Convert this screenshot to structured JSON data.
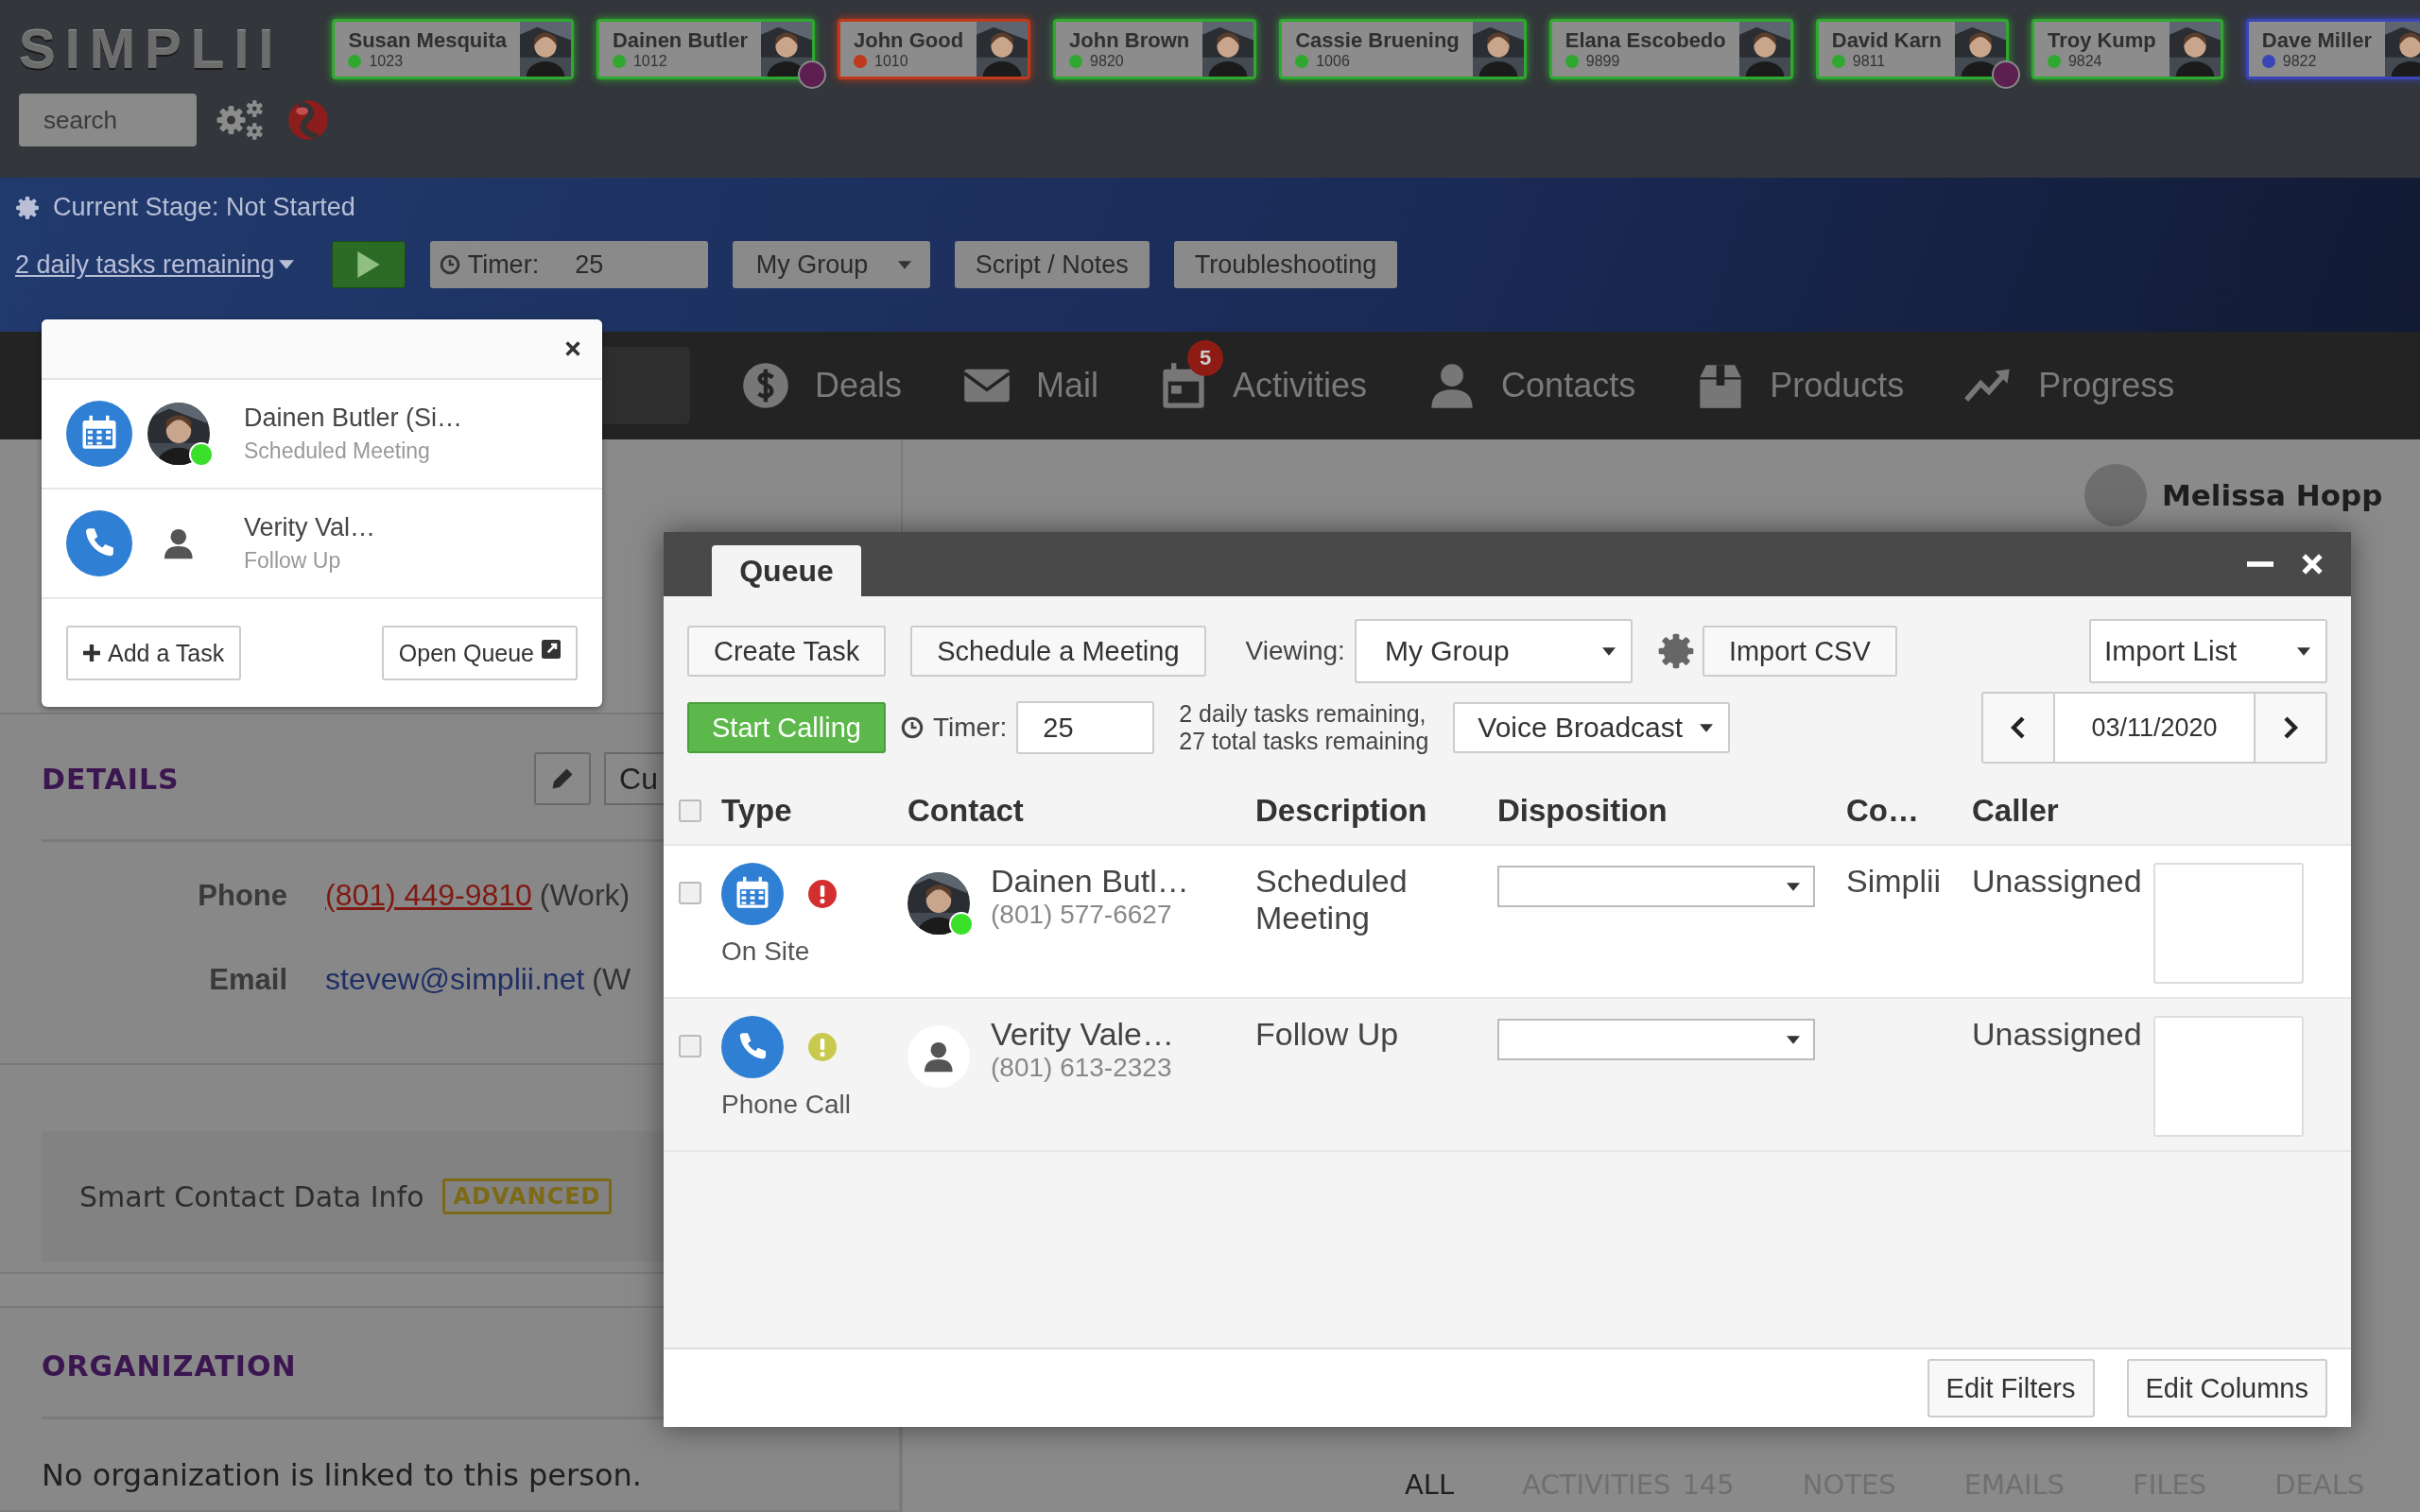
{
  "logo": "SIMPLII",
  "agents": [
    {
      "name": "Susan Mesquita",
      "ext": "1023",
      "color": "#2fa82f",
      "badge": false
    },
    {
      "name": "Dainen Butler",
      "ext": "1012",
      "color": "#2fa82f",
      "badge": true
    },
    {
      "name": "John Good",
      "ext": "1010",
      "color": "#c0391b",
      "badge": false
    },
    {
      "name": "John Brown",
      "ext": "9820",
      "color": "#2fa82f",
      "badge": false
    },
    {
      "name": "Cassie Bruening",
      "ext": "1006",
      "color": "#2fa82f",
      "badge": false
    },
    {
      "name": "Elana Escobedo",
      "ext": "9899",
      "color": "#2fa82f",
      "badge": false
    },
    {
      "name": "David Karn",
      "ext": "9811",
      "color": "#2fa82f",
      "badge": true
    },
    {
      "name": "Troy Kump",
      "ext": "9824",
      "color": "#2fa82f",
      "badge": false
    },
    {
      "name": "Dave Miller",
      "ext": "9822",
      "color": "#3a46b8",
      "badge": false
    }
  ],
  "search": {
    "placeholder": "search"
  },
  "stage": "Current Stage: Not Started",
  "tasks_link": "2 daily tasks remaining",
  "timer": {
    "label": "Timer:",
    "value": "25"
  },
  "group_select": "My Group",
  "stage_buttons": [
    "Script / Notes",
    "Troubleshooting"
  ],
  "nav": [
    {
      "label": "Deals"
    },
    {
      "label": "Mail"
    },
    {
      "label": "Activities",
      "badge": "5"
    },
    {
      "label": "Contacts"
    },
    {
      "label": "Products"
    },
    {
      "label": "Progress"
    }
  ],
  "user_name": "Melissa Hopp",
  "details": {
    "title": "DETAILS",
    "cut_button": "Cu",
    "fields": [
      {
        "label": "Phone",
        "value": "(801) 449-9810",
        "note": "(Work)",
        "kind": "phone"
      },
      {
        "label": "Email",
        "value": "stevew@simplii.net",
        "note": "(W",
        "kind": "email"
      }
    ],
    "smart": {
      "label": "Smart Contact Data Info",
      "tag": "ADVANCED"
    }
  },
  "organization": {
    "title": "ORGANIZATION",
    "text": "No organization is linked to this person."
  },
  "tabs": [
    {
      "label": "ALL",
      "selected": true
    },
    {
      "label": "ACTIVITIES",
      "count": "145",
      "selected": false
    },
    {
      "label": "NOTES",
      "selected": false
    },
    {
      "label": "EMAILS",
      "selected": false
    },
    {
      "label": "FILES",
      "selected": false
    },
    {
      "label": "DEALS",
      "selected": false
    }
  ],
  "popup": {
    "items": [
      {
        "name": "Dainen Butler (Si…",
        "desc": "Scheduled Meeting",
        "kind": "meeting",
        "has_photo": true,
        "online": true
      },
      {
        "name": "Verity Val…",
        "desc": "Follow Up",
        "kind": "call",
        "has_photo": false,
        "online": false
      }
    ],
    "add": "Add a Task",
    "open": "Open Queue"
  },
  "queue": {
    "tab": "Queue",
    "buttons": [
      "Create Task",
      "Schedule a Meeting"
    ],
    "viewing_label": "Viewing:",
    "viewing": "My Group",
    "import_csv": "Import CSV",
    "import_list": "Import List",
    "start": "Start Calling",
    "timer_label": "Timer:",
    "timer": "25",
    "remaining": [
      "2 daily tasks remaining,",
      "27 total tasks remaining"
    ],
    "broadcast": "Voice Broadcast",
    "date": "03/11/2020",
    "all_checked": false,
    "columns": [
      "Type",
      "Contact",
      "Description",
      "Disposition",
      "Co…",
      "Caller"
    ],
    "rows": [
      {
        "checked": false,
        "kind": "meeting",
        "type_label": "On Site",
        "color": "#d32f2f",
        "has_photo": true,
        "online": true,
        "name": "Dainen Butl…",
        "phone": "(801) 577-6627",
        "description": "Scheduled Meeting",
        "company": "Simplii",
        "caller": "Unassigned"
      },
      {
        "checked": false,
        "kind": "call",
        "type_label": "Phone Call",
        "color": "#c9c94e",
        "has_photo": false,
        "online": false,
        "name": "Verity Vale…",
        "phone": "(801) 613-2323",
        "description": "Follow Up",
        "caller": "Unassigned"
      }
    ],
    "footer": [
      "Edit Filters",
      "Edit Columns"
    ]
  }
}
